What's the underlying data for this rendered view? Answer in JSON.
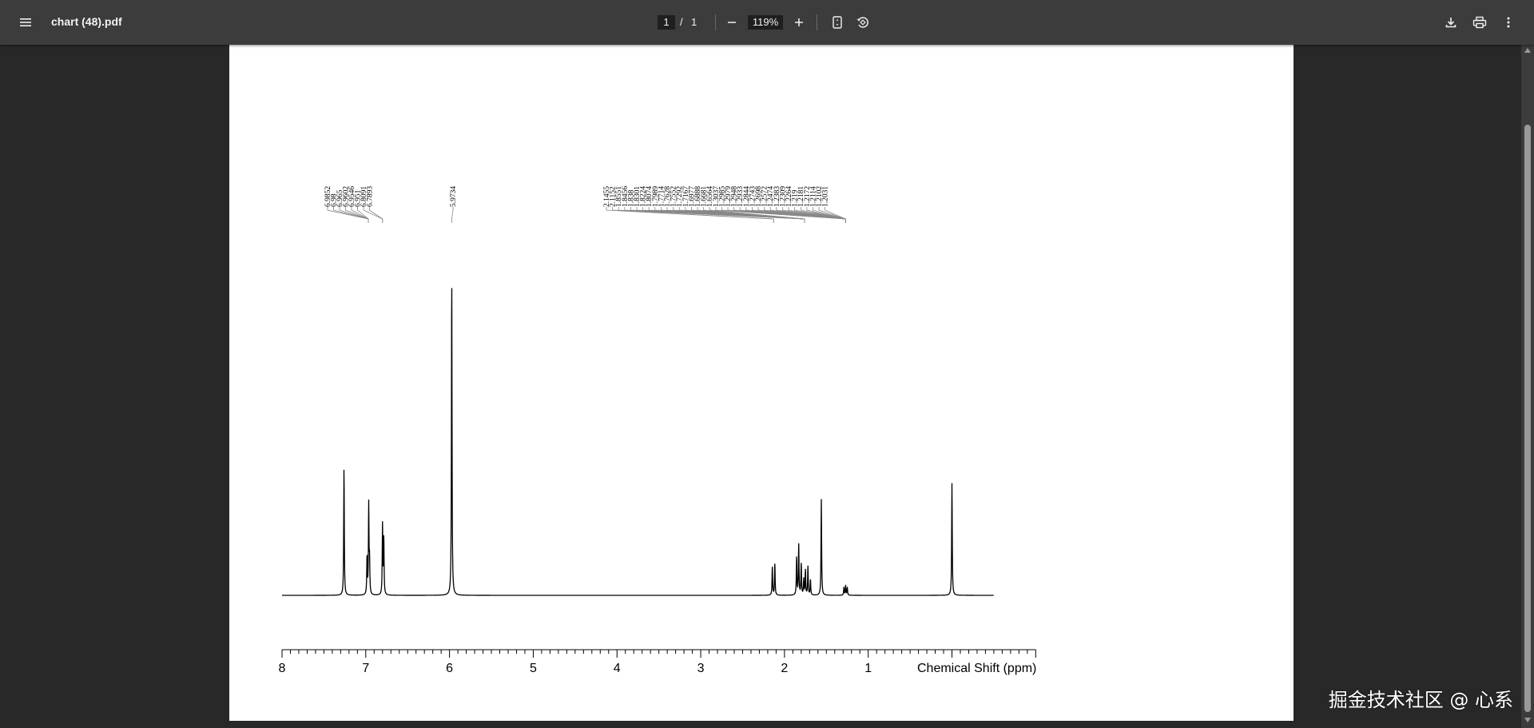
{
  "viewer": {
    "file_name": "chart (48).pdf",
    "current_page": "1",
    "page_separator": "/",
    "total_pages": "1",
    "zoom": "119%"
  },
  "icons": {
    "menu": "hamburger-menu-icon",
    "zoom_out": "minus-icon",
    "zoom_in": "plus-icon",
    "fit_page": "fit-to-page-icon",
    "rotate": "rotate-counterclockwise-icon",
    "download": "download-icon",
    "print": "print-icon",
    "more": "more-vertical-icon"
  },
  "watermark": "掘金技术社区 @ 心系",
  "chart_data": {
    "type": "line",
    "xlabel": "Chemical Shift (ppm)",
    "x_ticks": [
      "8",
      "7",
      "6",
      "5",
      "4",
      "3",
      "2",
      "1"
    ],
    "xlim": [
      8,
      0
    ],
    "x_reversed": true,
    "peaks": [
      {
        "ppm": 7.26,
        "intensity": 0.4
      },
      {
        "ppm": 6.985,
        "intensity": 0.12
      },
      {
        "ppm": 6.965,
        "intensity": 0.28
      },
      {
        "ppm": 6.955,
        "intensity": 0.1
      },
      {
        "ppm": 6.8,
        "intensity": 0.22
      },
      {
        "ppm": 6.785,
        "intensity": 0.18
      },
      {
        "ppm": 5.9734,
        "intensity": 1.0
      },
      {
        "ppm": 2.145,
        "intensity": 0.09
      },
      {
        "ppm": 2.115,
        "intensity": 0.1
      },
      {
        "ppm": 1.855,
        "intensity": 0.12
      },
      {
        "ppm": 1.83,
        "intensity": 0.16
      },
      {
        "ppm": 1.8,
        "intensity": 0.1
      },
      {
        "ppm": 1.77,
        "intensity": 0.05
      },
      {
        "ppm": 1.75,
        "intensity": 0.08
      },
      {
        "ppm": 1.72,
        "intensity": 0.09
      },
      {
        "ppm": 1.69,
        "intensity": 0.05
      },
      {
        "ppm": 1.56,
        "intensity": 0.3
      },
      {
        "ppm": 1.29,
        "intensity": 0.025
      },
      {
        "ppm": 1.27,
        "intensity": 0.03
      },
      {
        "ppm": 1.25,
        "intensity": 0.025
      },
      {
        "ppm": 0.0,
        "intensity": 0.35
      }
    ],
    "peak_label_groups": [
      {
        "labels": [
          "6.9852",
          "6.98",
          "6.965",
          "6.9602",
          "6.9546",
          "6.951"
        ],
        "target_ppm": 6.97
      },
      {
        "labels": [
          "6.8091",
          "6.7893"
        ],
        "target_ppm": 6.8
      },
      {
        "labels": [
          "5.9734"
        ],
        "target_ppm": 5.9734
      },
      {
        "labels": [
          "2.1455",
          "2.1152"
        ],
        "target_ppm": 2.13
      },
      {
        "labels": [
          "1.8551",
          "1.8456",
          "1.838",
          "1.8301",
          "1.8224",
          "1.8074",
          "1.7989",
          "1.7714",
          "1.7628",
          "1.7552",
          "1.7292",
          "1.7167",
          "1.6977",
          "1.6888",
          "1.6681",
          "1.6564"
        ],
        "target_ppm": 1.76
      },
      {
        "labels": [
          "1.3037",
          "1.2985",
          "1.2979",
          "1.2948",
          "1.2933",
          "1.2844",
          "1.2743",
          "1.2698",
          "1.2572",
          "1.2474",
          "1.2383",
          "1.2309",
          "1.2264",
          "1.219",
          "1.2181",
          "1.2172",
          "1.2114",
          "1.2102",
          "1.2031"
        ],
        "target_ppm": 1.27
      }
    ]
  }
}
